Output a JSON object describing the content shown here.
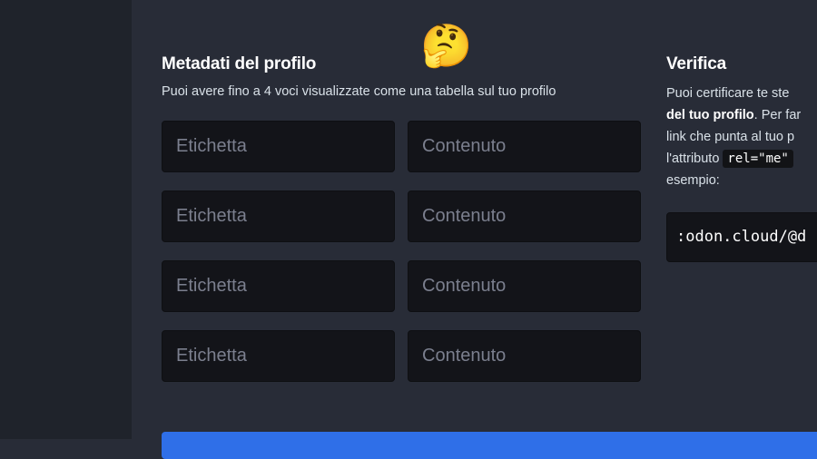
{
  "metadata": {
    "title": "Metadati del profilo",
    "hint": "Puoi avere fino a 4 voci visualizzate come una tabella sul tuo profilo",
    "rows": [
      {
        "label_placeholder": "Etichetta",
        "content_placeholder": "Contenuto"
      },
      {
        "label_placeholder": "Etichetta",
        "content_placeholder": "Contenuto"
      },
      {
        "label_placeholder": "Etichetta",
        "content_placeholder": "Contenuto"
      },
      {
        "label_placeholder": "Etichetta",
        "content_placeholder": "Contenuto"
      }
    ]
  },
  "verification": {
    "title": "Verifica",
    "hint_line1": "Puoi certificare te ste",
    "hint_line2_bold": "del tuo profilo",
    "hint_line2_rest": ". Per far",
    "hint_line3": "link che punta al tuo p",
    "hint_line4_pre": "l'attributo",
    "hint_code": "rel=\"me\"",
    "hint_line5": "esempio:",
    "link_value": ":odon.cloud/@d"
  },
  "emoji": "🤔",
  "colors": {
    "background": "#282c37",
    "sidebar": "#1f232b",
    "field": "#131419",
    "accent": "#2f6fe8"
  }
}
